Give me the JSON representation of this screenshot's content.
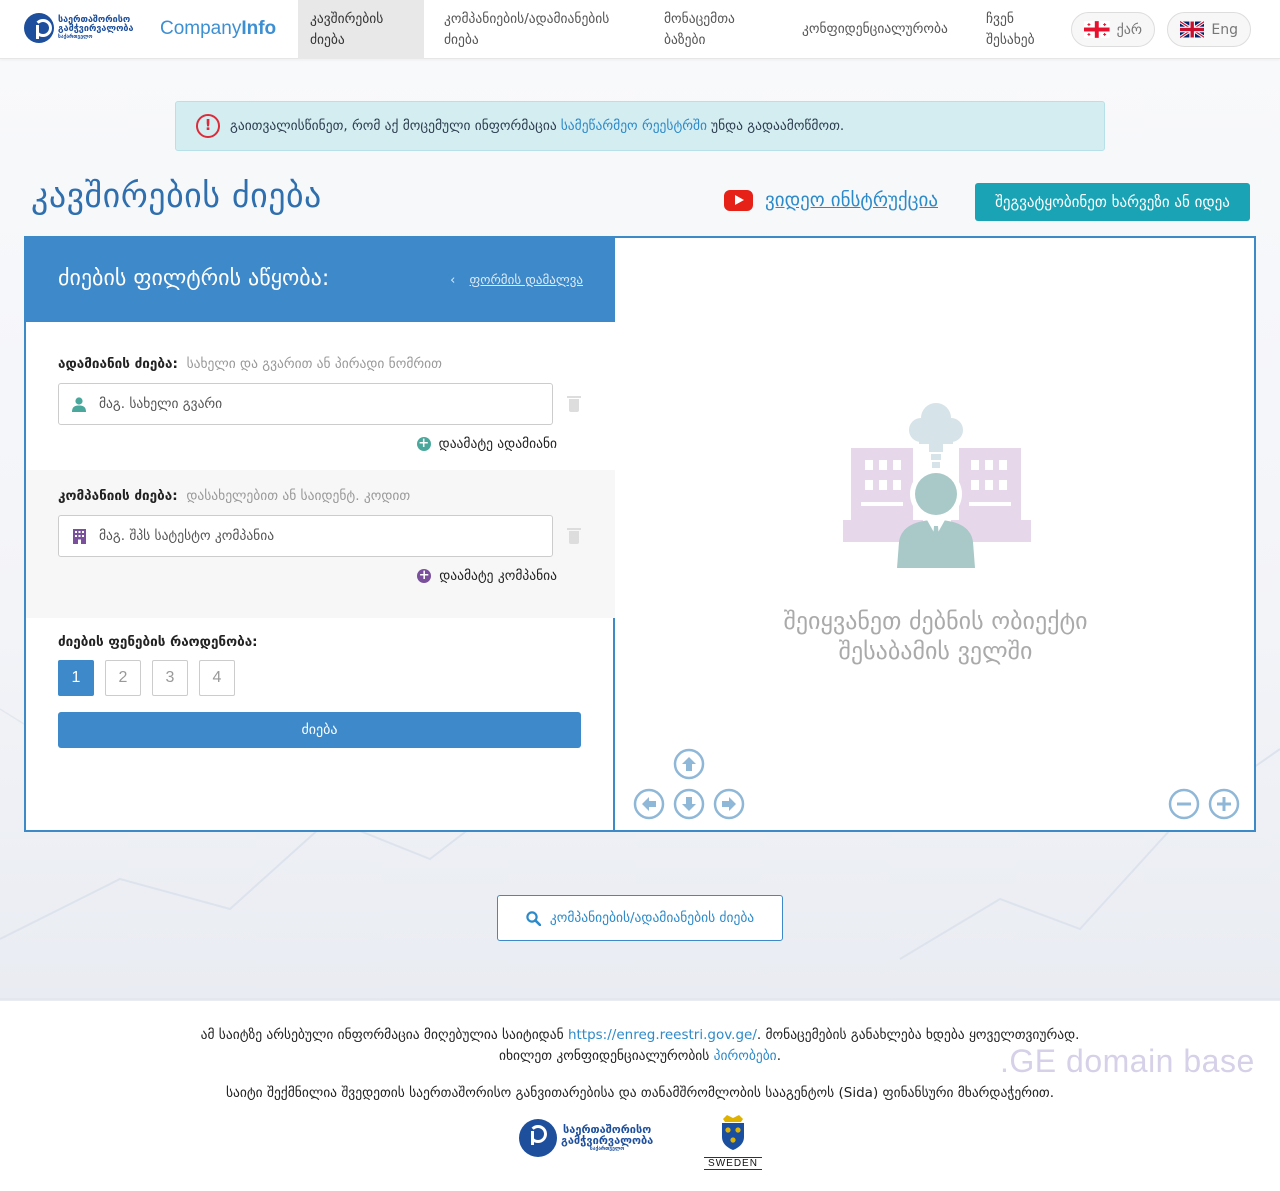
{
  "header": {
    "logo_text_line1": "საერთაშორისო",
    "logo_text_line2": "გამჭვირვალობა",
    "logo_text_line3": "საქართველო",
    "brand_part1": "Company",
    "brand_part2": "Info",
    "nav": [
      {
        "label_line1": "კავშირების",
        "label_line2": "ძიება"
      },
      {
        "label_line1": "კომპანიების/ადამიანების",
        "label_line2": "ძიება"
      },
      {
        "label_line1": "მონაცემთა",
        "label_line2": "ბაზები"
      },
      {
        "label_line1": "კონფიდენციალურობა",
        "label_line2": ""
      },
      {
        "label_line1": "ჩვენ",
        "label_line2": "შესახებ"
      }
    ],
    "lang_ka": "ქარ",
    "lang_en": "Eng"
  },
  "alert": {
    "text_before": "გაითვალისწინეთ, რომ აქ მოცემული ინფორმაცია",
    "link": "სამეწარმეო რეესტრში",
    "text_after": "უნდა გადაამოწმოთ."
  },
  "title": "კავშირების ძიება",
  "video_link": "ვიდეო ინსტრუქცია",
  "report_button": "შეგვატყობინეთ ხარვეზი ან იდეა",
  "filter": {
    "title": "ძიების ფილტრის აწყობა:",
    "hide_chevron": "‹",
    "hide_link": "ფორმის დამალვა",
    "person": {
      "label": "ადამიანის ძიება:",
      "hint": "სახელი და გვარით ან პირადი ნომრით",
      "placeholder": "მაგ. სახელი გვარი",
      "add": "დაამატე ადამიანი"
    },
    "company": {
      "label": "კომპანიის ძიება:",
      "hint": "დასახელებით ან საიდენტ. კოდით",
      "placeholder": "მაგ. შპს სატესტო კომპანია",
      "add": "დაამატე კომპანია"
    },
    "layers_label": "ძიების ფენების რაოდენობა:",
    "layers": [
      "1",
      "2",
      "3",
      "4"
    ],
    "search_button": "ძიება"
  },
  "result": {
    "empty_line1": "შეიყვანეთ ძებნის ობიექტი",
    "empty_line2": "შესაბამის ველში"
  },
  "bottom_search": "კომპანიების/ადამიანების ძიება",
  "footer": {
    "line1_before": "ამ საიტზე არსებული ინფორმაცია მიღებულია საიტიდან",
    "line1_link": "https://enreg.reestri.gov.ge/",
    "line1_after": ". მონაცემების განახლება ხდება ყოველთვიურად.",
    "line2_before": "იხილეთ კონფიდენციალურობის",
    "line2_link": "პირობები",
    "line2_after": ".",
    "line3": "საიტი შექმნილია შვედეთის საერთაშორისო განვითარებისა და თანამშრომლობის სააგენტოს (Sida) ფინანსური მხარდაჭერით.",
    "watermark": ".GE domain base",
    "sweden": "SWEDEN"
  },
  "colors": {
    "primary": "#3d89c9",
    "teal": "#1aa3b4",
    "alert_bg": "#d4edf1",
    "danger": "#dc2b3a",
    "person_icon": "#49a89b",
    "company_icon": "#7a4f9c"
  }
}
